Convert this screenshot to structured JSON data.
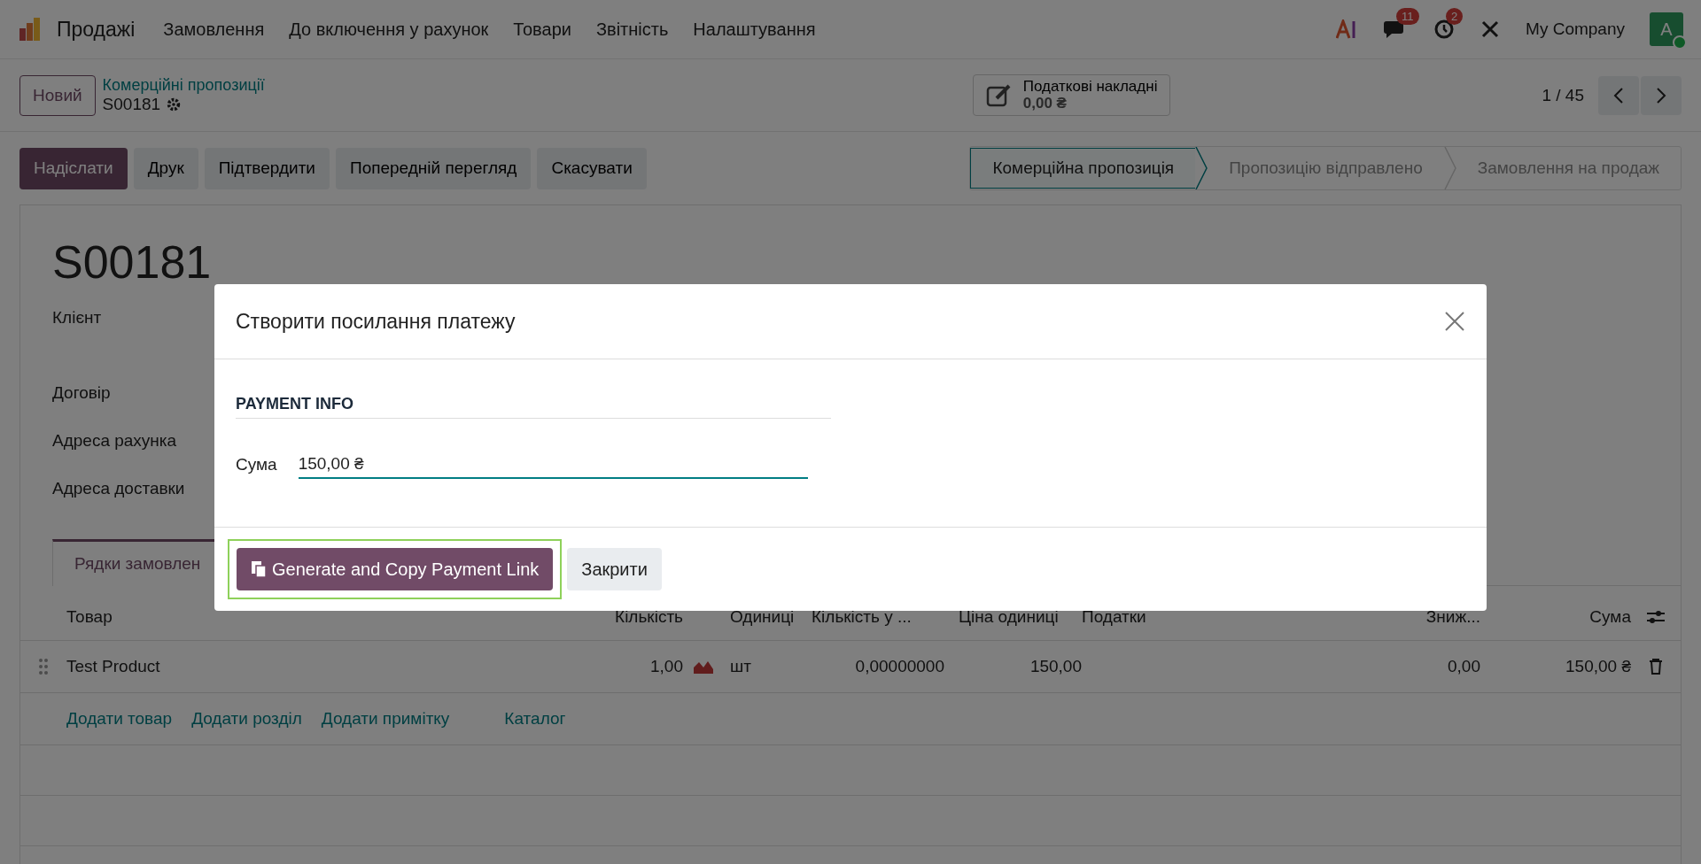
{
  "navbar": {
    "app": "Продажі",
    "menu": [
      "Замовлення",
      "До включення у рахунок",
      "Товари",
      "Звітність",
      "Налаштування"
    ],
    "chat_badge": "11",
    "activity_badge": "2",
    "company": "My Company",
    "avatar": "A"
  },
  "control_panel": {
    "new_button": "Новий",
    "breadcrumb": "Комерційні пропозиції",
    "record": "S00181",
    "smart_button": {
      "label": "Податкові накладні",
      "value": "0,00 ₴"
    },
    "pager": "1 / 45"
  },
  "actions": [
    {
      "label": "Надіслати",
      "primary": true
    },
    {
      "label": "Друк",
      "primary": false
    },
    {
      "label": "Підтвердити",
      "primary": false
    },
    {
      "label": "Попередній перегляд",
      "primary": false
    },
    {
      "label": "Скасувати",
      "primary": false
    }
  ],
  "stages": [
    {
      "label": "Комерційна пропозиція",
      "selected": true
    },
    {
      "label": "Пропозицію відправлено",
      "selected": false
    },
    {
      "label": "Замовлення на продаж",
      "selected": false
    }
  ],
  "form": {
    "title": "S00181",
    "fields": [
      "Клієнт",
      "Договір",
      "Адреса рахунка",
      "Адреса доставки"
    ],
    "tabs": [
      {
        "label": "Рядки замовлен",
        "selected": true
      }
    ],
    "table": {
      "columns": [
        "Товар",
        "Кількість",
        "Одиниці",
        "Кількість у ...",
        "Ціна одиниці",
        "Податки",
        "Зниж...",
        "Сума"
      ],
      "rows": [
        {
          "product": "Test Product",
          "quantity": "1,00",
          "units": "шт",
          "qty_invoiced": "0,00000000",
          "unit_price": "150,00",
          "discount": "0,00",
          "total": "150,00 ₴"
        }
      ],
      "add_links": [
        {
          "label": "Додати товар",
          "kind": "add"
        },
        {
          "label": "Додати розділ",
          "kind": "add"
        },
        {
          "label": "Додати примітку",
          "kind": "add"
        },
        {
          "label": "Каталог",
          "kind": "catalog"
        }
      ]
    }
  },
  "dialog": {
    "title": "Створити посилання платежу",
    "section": "PAYMENT INFO",
    "field": {
      "label": "Сума",
      "value": "150,00 ₴"
    },
    "buttons": [
      {
        "label": "Generate and Copy Payment Link",
        "kind": "primary",
        "highlighted": true
      },
      {
        "label": "Закрити",
        "kind": "secondary",
        "highlighted": false
      }
    ]
  }
}
